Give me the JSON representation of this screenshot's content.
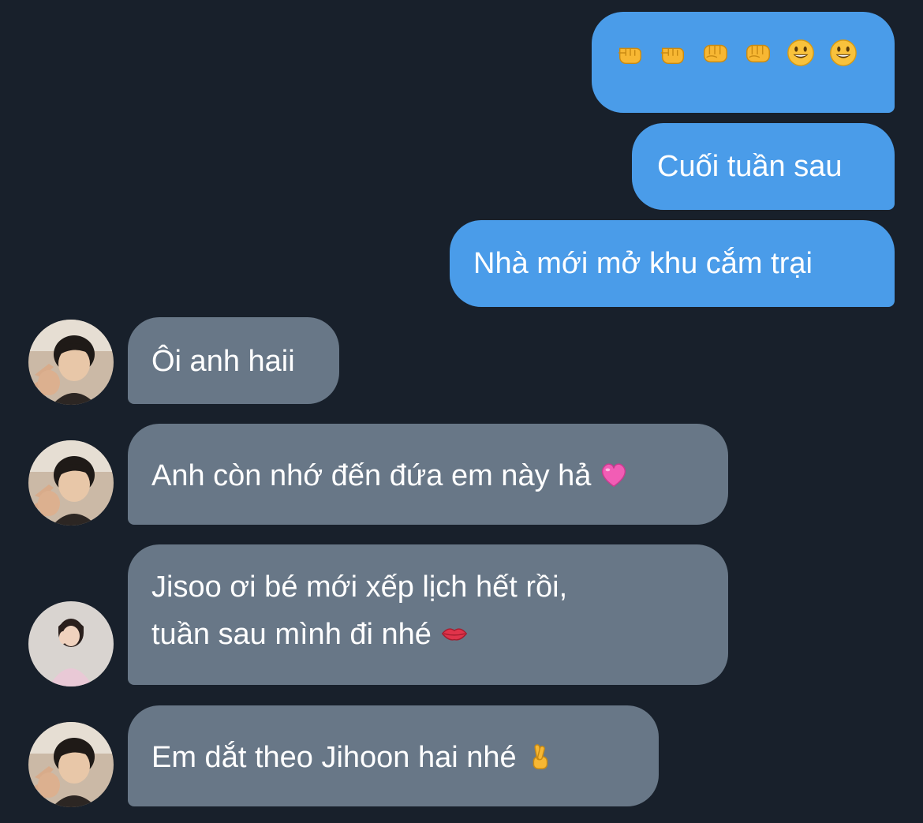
{
  "messages": {
    "m1": {
      "direction": "outgoing",
      "emojis": [
        "fist-right-icon",
        "fist-right-icon",
        "fist-oncoming-icon",
        "fist-oncoming-icon",
        "smiley-icon",
        "smiley-icon"
      ]
    },
    "m2": {
      "direction": "outgoing",
      "text": "Cuối tuần sau"
    },
    "m3": {
      "direction": "outgoing",
      "text": "Nhà mới mở khu cắm trại"
    },
    "m4": {
      "direction": "incoming",
      "sender_avatar": "avatar-boy",
      "text": "Ôi anh haii"
    },
    "m5": {
      "direction": "incoming",
      "sender_avatar": "avatar-boy",
      "text": "Anh còn nhớ đến đứa em này hả",
      "emoji": "pink-heart-icon"
    },
    "m6": {
      "direction": "incoming",
      "sender_avatar": "avatar-girl",
      "line1": "Jisoo ơi bé mới xếp lịch hết rồi,",
      "line2": "tuần sau mình đi nhé",
      "emoji": "kiss-mark-icon"
    },
    "m7": {
      "direction": "incoming",
      "sender_avatar": "avatar-boy",
      "text": "Em dắt theo Jihoon hai nhé",
      "emoji": "crossed-fingers-icon"
    }
  },
  "colors": {
    "background": "#18202b",
    "outgoing_bubble": "#4a9ce9",
    "incoming_bubble": "#687787",
    "text": "#ffffff"
  }
}
